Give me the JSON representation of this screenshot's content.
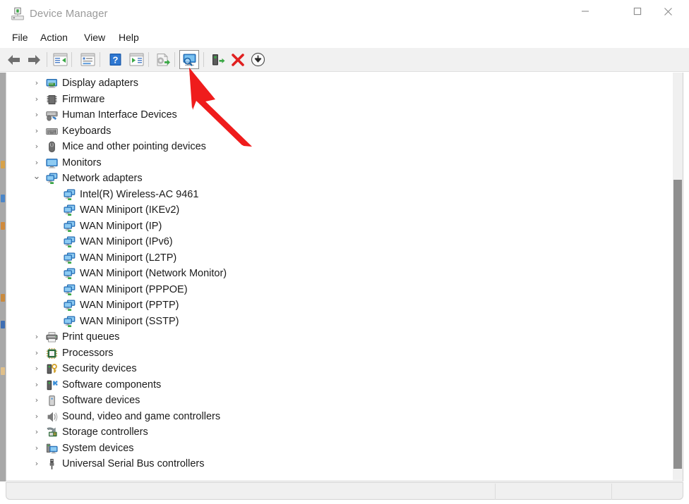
{
  "window": {
    "title": "Device Manager",
    "title_icon": "device-manager-icon",
    "controls": [
      {
        "name": "minimize-button",
        "glyph": "minimize-icon"
      },
      {
        "name": "maximize-button",
        "glyph": "maximize-icon"
      },
      {
        "name": "close-button",
        "glyph": "close-icon"
      }
    ]
  },
  "menubar": {
    "items": [
      {
        "label": "File"
      },
      {
        "label": "Action"
      },
      {
        "label": "View"
      },
      {
        "label": "Help"
      }
    ]
  },
  "toolbar": {
    "buttons": [
      {
        "name": "back-button",
        "icon": "back-arrow-icon",
        "selected": false
      },
      {
        "name": "forward-button",
        "icon": "forward-arrow-icon",
        "selected": false
      },
      {
        "name": "show-hide-console-tree-button",
        "icon": "console-tree-icon",
        "selected": false
      },
      {
        "name": "properties-button",
        "icon": "properties-icon",
        "selected": false
      },
      {
        "name": "help-button",
        "icon": "help-question-icon",
        "selected": false
      },
      {
        "name": "show-hide-action-pane-button",
        "icon": "action-pane-icon",
        "selected": false
      },
      {
        "name": "update-driver-button",
        "icon": "update-driver-icon",
        "selected": false
      },
      {
        "name": "scan-for-hardware-changes-button",
        "icon": "scan-hardware-icon",
        "selected": true
      },
      {
        "name": "disable-device-button",
        "icon": "disable-device-icon",
        "selected": false
      },
      {
        "name": "uninstall-device-button",
        "icon": "uninstall-red-x-icon",
        "selected": false
      },
      {
        "name": "download-button",
        "icon": "download-arrow-icon",
        "selected": false
      }
    ]
  },
  "tree": {
    "rows": [
      {
        "label": "Display adapters",
        "depth": 0,
        "state": "collapsed",
        "icon": "display-adapter-icon"
      },
      {
        "label": "Firmware",
        "depth": 0,
        "state": "collapsed",
        "icon": "firmware-chip-icon"
      },
      {
        "label": "Human Interface Devices",
        "depth": 0,
        "state": "collapsed",
        "icon": "human-interface-icon"
      },
      {
        "label": "Keyboards",
        "depth": 0,
        "state": "collapsed",
        "icon": "keyboard-icon"
      },
      {
        "label": "Mice and other pointing devices",
        "depth": 0,
        "state": "collapsed",
        "icon": "mouse-icon"
      },
      {
        "label": "Monitors",
        "depth": 0,
        "state": "collapsed",
        "icon": "monitor-icon"
      },
      {
        "label": "Network adapters",
        "depth": 0,
        "state": "expanded",
        "icon": "network-adapter-icon"
      },
      {
        "label": "Intel(R) Wireless-AC 9461",
        "depth": 1,
        "state": "leaf",
        "icon": "network-adapter-icon"
      },
      {
        "label": "WAN Miniport (IKEv2)",
        "depth": 1,
        "state": "leaf",
        "icon": "network-adapter-icon"
      },
      {
        "label": "WAN Miniport (IP)",
        "depth": 1,
        "state": "leaf",
        "icon": "network-adapter-icon"
      },
      {
        "label": "WAN Miniport (IPv6)",
        "depth": 1,
        "state": "leaf",
        "icon": "network-adapter-icon"
      },
      {
        "label": "WAN Miniport (L2TP)",
        "depth": 1,
        "state": "leaf",
        "icon": "network-adapter-icon"
      },
      {
        "label": "WAN Miniport (Network Monitor)",
        "depth": 1,
        "state": "leaf",
        "icon": "network-adapter-icon"
      },
      {
        "label": "WAN Miniport (PPPOE)",
        "depth": 1,
        "state": "leaf",
        "icon": "network-adapter-icon"
      },
      {
        "label": "WAN Miniport (PPTP)",
        "depth": 1,
        "state": "leaf",
        "icon": "network-adapter-icon"
      },
      {
        "label": "WAN Miniport (SSTP)",
        "depth": 1,
        "state": "leaf",
        "icon": "network-adapter-icon"
      },
      {
        "label": "Print queues",
        "depth": 0,
        "state": "collapsed",
        "icon": "printer-icon"
      },
      {
        "label": "Processors",
        "depth": 0,
        "state": "collapsed",
        "icon": "processor-icon"
      },
      {
        "label": "Security devices",
        "depth": 0,
        "state": "collapsed",
        "icon": "security-device-icon"
      },
      {
        "label": "Software components",
        "depth": 0,
        "state": "collapsed",
        "icon": "software-component-icon"
      },
      {
        "label": "Software devices",
        "depth": 0,
        "state": "collapsed",
        "icon": "software-device-icon"
      },
      {
        "label": "Sound, video and game controllers",
        "depth": 0,
        "state": "collapsed",
        "icon": "speaker-icon"
      },
      {
        "label": "Storage controllers",
        "depth": 0,
        "state": "collapsed",
        "icon": "storage-controller-icon"
      },
      {
        "label": "System devices",
        "depth": 0,
        "state": "collapsed",
        "icon": "system-device-icon"
      },
      {
        "label": "Universal Serial Bus controllers",
        "depth": 0,
        "state": "collapsed",
        "icon": "usb-icon"
      }
    ],
    "chevron_collapsed": "›",
    "chevron_expanded": "⌄"
  },
  "scrollbar": {
    "name": "vertical-scrollbar",
    "thumb_name": "vertical-scrollbar-thumb"
  },
  "statusbar": {
    "text": ""
  },
  "annotation": {
    "type": "arrow",
    "color": "#ef1c1c",
    "points_to": "scan-for-hardware-changes-button"
  },
  "colors": {
    "titlebar_bg": "#ffffff",
    "toolbar_bg": "#f1f1f1",
    "content_bg": "#ffffff",
    "text": "#1b1b1b",
    "title_text": "#9a9a9a",
    "scrollbar_thumb": "#8f8f8f",
    "annotation_red": "#ef1c1c"
  }
}
